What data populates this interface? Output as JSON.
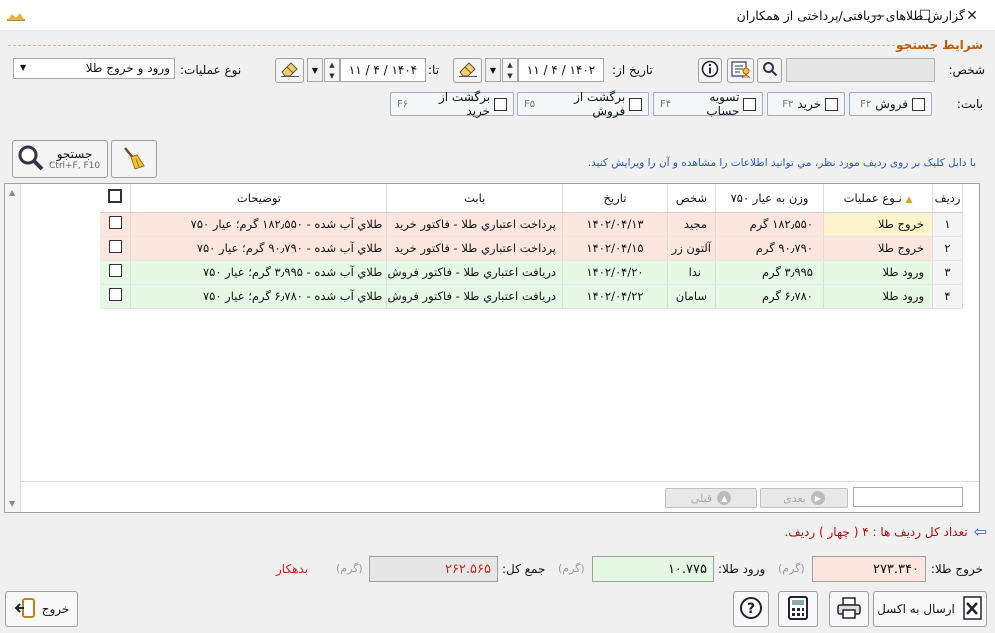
{
  "window": {
    "title": "گزارش طلاهای دریافتی/پرداختی از همکاران",
    "minimize": "—",
    "maximize": "☐",
    "close": "✕"
  },
  "search": {
    "section_title": "شرایط جستجو",
    "person_label": "شخص:",
    "person_value": "",
    "date_from_label": "تاریخ از:",
    "date_from": "۱۱ / ۴ / ۱۴۰۲",
    "date_to_label": "تا:",
    "date_to": "۱۱ / ۴ / ۱۴۰۴",
    "op_type_label": "نوع عملیات:",
    "op_type_value": "ورود و خروج طلا",
    "category_label": "بابت:",
    "filters": [
      {
        "label": "فروش",
        "key": "F۲"
      },
      {
        "label": "خرید",
        "key": "F۳"
      },
      {
        "label": "تسویه حساب",
        "key": "F۴"
      },
      {
        "label": "برگشت از فروش",
        "key": "F۵"
      },
      {
        "label": "برگشت از خرید",
        "key": "F۶"
      }
    ],
    "search_button": "جستجو",
    "search_shortcut": "Ctrl+F, F10",
    "hint": "با دابل كليک بر روی رديف مورد نظر، مي توانيد اطلاعات ‌را مشاهده و آن را ويرايش كنيد."
  },
  "table": {
    "headers": [
      "رديف",
      "نـوع عمليات",
      "وزن به عيار ۷۵۰",
      "شخص",
      "تاريخ",
      "بابت",
      "توضيحات"
    ],
    "rows": [
      {
        "index": "۱",
        "type": "خروج طلا",
        "weight": "۱۸۲٫۵۵۰ گرم",
        "person": "مجيد",
        "date": "۱۴۰۲/۰۴/۱۳",
        "category": "پرداخت اعتباري طلا - فاكتور خريد",
        "desc": "طلاي آب شده - ۱۸۲٫۵۵۰ گرم؛ عيار ۷۵۰",
        "tone": "pink"
      },
      {
        "index": "۲",
        "type": "خروج طلا",
        "weight": "۹۰٫۷۹۰ گرم",
        "person": "آلتون زر",
        "date": "۱۴۰۲/۰۴/۱۵",
        "category": "پرداخت اعتباري طلا - فاكتور خريد",
        "desc": "طلاي آب شده - ۹۰٫۷۹۰ گرم؛ عيار ۷۵۰",
        "tone": "pink"
      },
      {
        "index": "۳",
        "type": "ورود طلا",
        "weight": "۳٫۹۹۵ گرم",
        "person": "ندا",
        "date": "۱۴۰۲/۰۴/۲۰",
        "category": "دريافت اعتباري طلا - فاكتور فروش",
        "desc": "طلاي آب شده - ۳٫۹۹۵ گرم؛ عيار ۷۵۰",
        "tone": "green"
      },
      {
        "index": "۴",
        "type": "ورود طلا",
        "weight": "۶٫۷۸۰ گرم",
        "person": "سامان",
        "date": "۱۴۰۲/۰۴/۲۲",
        "category": "دريافت اعتباري طلا - فاكتور فروش",
        "desc": "طلاي آب شده - ۶٫۷۸۰ گرم؛ عيار ۷۵۰",
        "tone": "green"
      }
    ],
    "next_label": "بعدی",
    "prev_label": "قبلی"
  },
  "summary": {
    "row_count": "تعداد كل رديف ها : ۴ ( چهار ) رديف.",
    "gold_out_label": "خروج طلا:",
    "gold_out_value": "۲۷۳.۳۴۰",
    "gold_in_label": "ورود طلا:",
    "gold_in_value": "۱۰.۷۷۵",
    "total_label": "جمع كل:",
    "total_value": "۲۶۲.۵۶۵",
    "unit": "(گرم)",
    "status": "بدهكار"
  },
  "footer": {
    "exit": "خروج",
    "excel": "ارسال به اكسل"
  },
  "colors": {
    "out_bg": "#fde6dd",
    "in_bg": "#e4f8e4",
    "accent": "#b85c10",
    "status": "#d0201a",
    "hint": "#2a58b8"
  }
}
